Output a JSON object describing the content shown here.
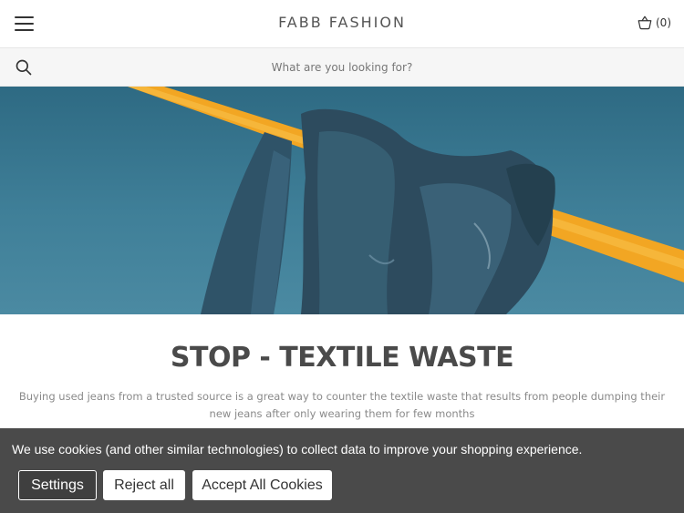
{
  "header": {
    "brand": "FABB FASHION",
    "cart_count": "(0)"
  },
  "search": {
    "placeholder": "What are you looking for?"
  },
  "hero": {
    "image_subject": "jeans hanging on yellow bar against blue sky",
    "colors": {
      "sky": "#3f7f98",
      "bar": "#f2a623",
      "denim": "#2d4b5e"
    }
  },
  "article": {
    "title": "STOP - TEXTILE WASTE",
    "description": "Buying used jeans from a trusted source is a great way to counter the textile waste that results from people dumping their new jeans after only wearing them for few months"
  },
  "cookie_banner": {
    "message": "We use cookies (and other similar technologies) to collect data to improve your shopping experience.",
    "settings_label": "Settings",
    "reject_label": "Reject all",
    "accept_label": "Accept All Cookies"
  }
}
